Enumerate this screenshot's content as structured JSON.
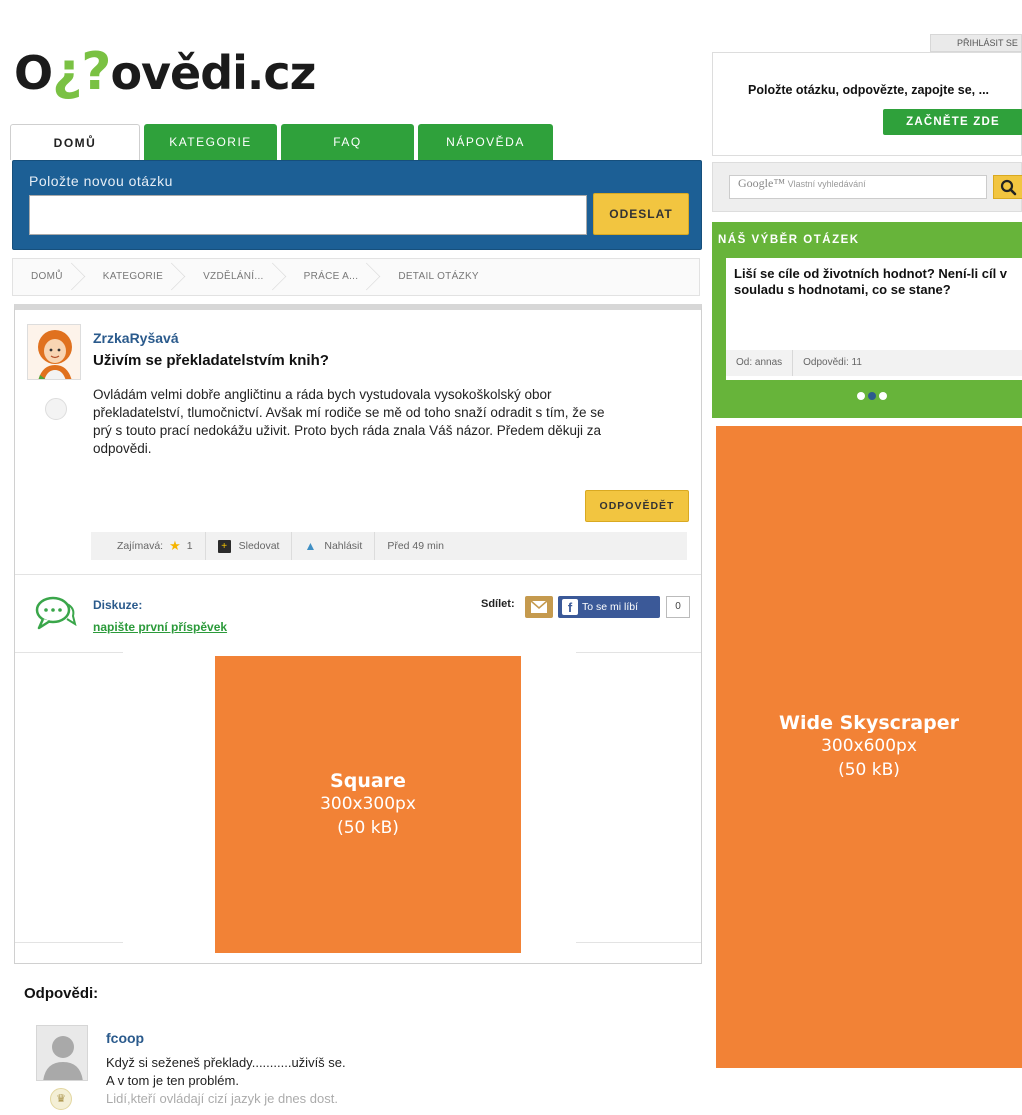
{
  "brand": {
    "logo_prefix": "O",
    "logo_mark": "¿?",
    "logo_suffix": "ovědi.cz"
  },
  "nav": {
    "tabs": [
      {
        "label": "DOMŮ",
        "active": true
      },
      {
        "label": "KATEGORIE",
        "active": false
      },
      {
        "label": "FAQ",
        "active": false
      },
      {
        "label": "NÁPOVĚDA",
        "active": false
      }
    ]
  },
  "ask": {
    "label": "Položte novou otázku",
    "input_value": "",
    "submit_label": "ODESLAT"
  },
  "breadcrumb": [
    "DOMŮ",
    "KATEGORIE",
    "VZDĚLÁNÍ...",
    "PRÁCE A...",
    "DETAIL OTÁZKY"
  ],
  "question": {
    "author": "ZrzkaRyšavá",
    "title": "Uživím se překladatelstvím knih?",
    "body_lines": [
      "Ovládám velmi dobře angličtinu a ráda bych vystudovala vysokoškolský obor",
      "překladatelství, tlumočnictví. Avšak mí rodiče se mě od toho snaží odradit s tím, že se",
      "prý s touto prací nedokážu uživit. Proto bych ráda znala Váš názor. Předem děkuji za",
      "odpovědi."
    ],
    "answer_button": "ODPOVĚDĚT",
    "meta": {
      "interesting_label": "Zajímavá:",
      "interesting_count": "1",
      "follow_label": "Sledovat",
      "report_label": "Nahlásit",
      "time": "Před 49 min"
    }
  },
  "discussion": {
    "label": "Diskuze:",
    "link": "napište první příspěvek",
    "share_label": "Sdílet:",
    "fb_like_label": "To se mi líbí",
    "fb_count": "0"
  },
  "ads": {
    "square": {
      "name": "Square",
      "size": "300x300px",
      "weight": "(50 kB)"
    },
    "skyscraper": {
      "name": "Wide Skyscraper",
      "size": "300x600px",
      "weight": "(50 kB)"
    },
    "color": "#f28236"
  },
  "answers": {
    "title": "Odpovědi:",
    "items": [
      {
        "author": "fcoop",
        "lines": [
          "Když si seženeš překlady...........uživíš se.",
          "A v tom je ten problém.",
          "Lidí,kteří ovládají cizí jazyk je dnes dost."
        ]
      }
    ]
  },
  "sidebar": {
    "login_label": "PŘIHLÁSIT SE",
    "promo_text": "Položte otázku, odpovězte, zapojte se, ...",
    "promo_button": "ZAČNĚTE ZDE",
    "search_brand": "Google™",
    "search_placeholder": "Vlastní vyhledávání",
    "pick": {
      "title": "NÁŠ VÝBĚR OTÁZEK",
      "question": "Liší se cíle od životních hodnot? Není-li cíl v souladu s hodnotami, co se stane?",
      "from": "Od: annas",
      "answers": "Odpovědi: 11",
      "active_dot": 1
    }
  },
  "colors": {
    "green": "#2fa13b",
    "blue": "#1c5f95",
    "yellow": "#f2c540",
    "link_blue": "#2a5a8c"
  }
}
